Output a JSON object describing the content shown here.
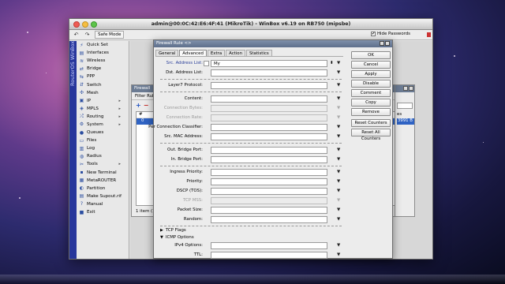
{
  "window": {
    "title": "admin@00:0C:42:E6:4F:41 (MikroTik) - WinBox v6.19 on RB750 (mipsbe)",
    "safe_mode": "Safe Mode",
    "hide_passwords": "Hide Passwords",
    "hide_passwords_checked": true,
    "brand": "RouterOS WinBox"
  },
  "toolbar": {
    "undo_glyph": "↶",
    "redo_glyph": "↷",
    "check_glyph": "✔"
  },
  "sidebar": {
    "items": [
      {
        "label": "Quick Set",
        "icon": "quick-set-icon",
        "glyph": "⚡"
      },
      {
        "label": "Interfaces",
        "icon": "interfaces-icon",
        "glyph": "▤"
      },
      {
        "label": "Wireless",
        "icon": "wireless-icon",
        "glyph": "≋"
      },
      {
        "label": "Bridge",
        "icon": "bridge-icon",
        "glyph": "⇄"
      },
      {
        "label": "PPP",
        "icon": "ppp-icon",
        "glyph": "⇆"
      },
      {
        "label": "Switch",
        "icon": "switch-icon",
        "glyph": "⇵"
      },
      {
        "label": "Mesh",
        "icon": "mesh-icon",
        "glyph": "✣"
      },
      {
        "label": "IP",
        "icon": "ip-icon",
        "glyph": "▣",
        "has_submenu": true
      },
      {
        "label": "MPLS",
        "icon": "mpls-icon",
        "glyph": "◈",
        "has_submenu": true
      },
      {
        "label": "Routing",
        "icon": "routing-icon",
        "glyph": "⤮",
        "has_submenu": true
      },
      {
        "label": "System",
        "icon": "system-icon",
        "glyph": "⚙",
        "has_submenu": true
      },
      {
        "label": "Queues",
        "icon": "queues-icon",
        "glyph": "●"
      },
      {
        "label": "Files",
        "icon": "files-icon",
        "glyph": "▭"
      },
      {
        "label": "Log",
        "icon": "log-icon",
        "glyph": "▥"
      },
      {
        "label": "Radius",
        "icon": "radius-icon",
        "glyph": "◍"
      },
      {
        "label": "Tools",
        "icon": "tools-icon",
        "glyph": "✂",
        "has_submenu": true
      },
      {
        "label": "New Terminal",
        "icon": "terminal-icon",
        "glyph": "▪"
      },
      {
        "label": "MetaROUTER",
        "icon": "metarouter-icon",
        "glyph": "▦"
      },
      {
        "label": "Partition",
        "icon": "partition-icon",
        "glyph": "◐"
      },
      {
        "label": "Make Supout.rif",
        "icon": "supout-icon",
        "glyph": "▤"
      },
      {
        "label": "Manual",
        "icon": "manual-icon",
        "glyph": "?"
      },
      {
        "label": "Exit",
        "icon": "exit-icon",
        "glyph": "■"
      }
    ],
    "submenu_glyph": "▸"
  },
  "firewall_back": {
    "title": "Firewall",
    "tab": "Filter Rul",
    "add_glyph": "+",
    "remove_glyph": "−",
    "hash_header": "#",
    "row_num": "0",
    "items_count": "1 item (1",
    "right_header": "es",
    "right_value": "3991 B"
  },
  "dialog": {
    "title": "Firewall Rule <>",
    "tabs": [
      "General",
      "Advanced",
      "Extra",
      "Action",
      "Statistics"
    ],
    "active_tab": "Advanced",
    "fields": {
      "src_address_list": {
        "label": "Src. Address List:",
        "value": "My"
      },
      "dst_address_list": {
        "label": "Dst. Address List:",
        "value": ""
      },
      "layer7_protocol": {
        "label": "Layer7 Protocol:",
        "value": ""
      },
      "content": {
        "label": "Content:",
        "value": ""
      },
      "connection_bytes": {
        "label": "Connection Bytes:",
        "value": ""
      },
      "connection_rate": {
        "label": "Connection Rate:",
        "value": ""
      },
      "per_connection_classifier": {
        "label": "Per Connection Classifier:",
        "value": ""
      },
      "src_mac_address": {
        "label": "Src. MAC Address:",
        "value": ""
      },
      "out_bridge_port": {
        "label": "Out. Bridge Port:",
        "value": ""
      },
      "in_bridge_port": {
        "label": "In. Bridge Port:",
        "value": ""
      },
      "ingress_priority": {
        "label": "Ingress Priority:",
        "value": ""
      },
      "priority": {
        "label": "Priority:",
        "value": ""
      },
      "dscp_tos": {
        "label": "DSCP (TOS):",
        "value": ""
      },
      "tcp_mss": {
        "label": "TCP MSS:",
        "value": ""
      },
      "packet_size": {
        "label": "Packet Size:",
        "value": ""
      },
      "random": {
        "label": "Random:",
        "value": ""
      },
      "ipv4_options": {
        "label": "IPv4 Options:",
        "value": ""
      },
      "ttl": {
        "label": "TTL:",
        "value": ""
      }
    },
    "sections": {
      "tcp_flags": "TCP Flags",
      "icmp_options": "ICMP Options"
    },
    "dropdown_glyph": "▼",
    "updown_glyph": "⬍",
    "collapsed_glyph": "▶",
    "expanded_glyph": "▼",
    "buttons": {
      "ok": "OK",
      "cancel": "Cancel",
      "apply": "Apply",
      "disable": "Disable",
      "comment": "Comment",
      "copy": "Copy",
      "remove": "Remove",
      "reset_counters": "Reset Counters",
      "reset_all_counters": "Reset All Counters"
    }
  }
}
